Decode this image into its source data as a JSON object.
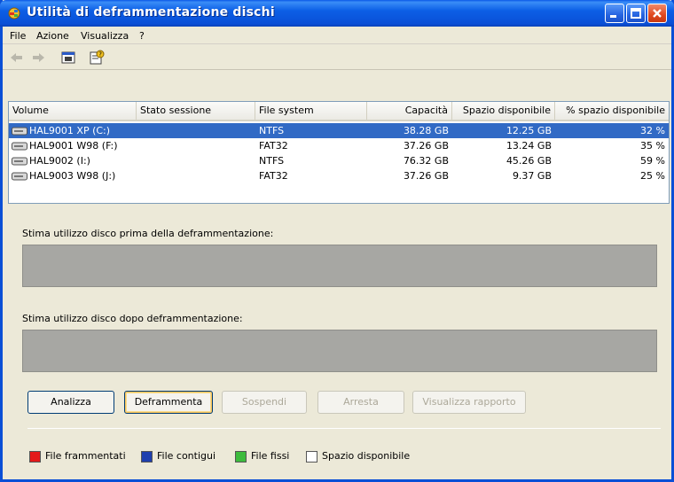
{
  "window": {
    "title": "Utilità di deframmentazione dischi",
    "title_color": "#ffffff",
    "accent": "#0a4fd6"
  },
  "menu": [
    "File",
    "Azione",
    "Visualizza",
    "?"
  ],
  "toolbar": {
    "icons": [
      "back-arrow-icon",
      "forward-arrow-icon",
      "console-view-icon",
      "properties-help-icon"
    ]
  },
  "columns": [
    "Volume",
    "Stato sessione",
    "File system",
    "Capacità",
    "Spazio disponibile",
    "% spazio disponibile"
  ],
  "volumes": [
    {
      "volume": "HAL9001 XP (C:)",
      "status": "",
      "fs": "NTFS",
      "capacity": "38.28 GB",
      "free": "12.25 GB",
      "pct": "32 %",
      "selected": true
    },
    {
      "volume": "HAL9001 W98 (F:)",
      "status": "",
      "fs": "FAT32",
      "capacity": "37.26 GB",
      "free": "13.24 GB",
      "pct": "35 %",
      "selected": false
    },
    {
      "volume": "HAL9002 (I:)",
      "status": "",
      "fs": "NTFS",
      "capacity": "76.32 GB",
      "free": "45.26 GB",
      "pct": "59 %",
      "selected": false
    },
    {
      "volume": "HAL9003 W98 (J:)",
      "status": "",
      "fs": "FAT32",
      "capacity": "37.26 GB",
      "free": "9.37 GB",
      "pct": "25 %",
      "selected": false
    }
  ],
  "estimate_before_label": "Stima utilizzo disco prima della deframmentazione:",
  "estimate_after_label": "Stima utilizzo disco dopo deframmentazione:",
  "buttons": {
    "analyze": "Analizza",
    "defrag": "Deframmenta",
    "pause": "Sospendi",
    "stop": "Arresta",
    "report": "Visualizza rapporto"
  },
  "legend": [
    {
      "label": "File frammentati",
      "color": "#e41a1a"
    },
    {
      "label": "File contigui",
      "color": "#1f3fae"
    },
    {
      "label": "File fissi",
      "color": "#3dbb3d"
    },
    {
      "label": "Spazio disponibile",
      "color": "#ffffff"
    }
  ]
}
